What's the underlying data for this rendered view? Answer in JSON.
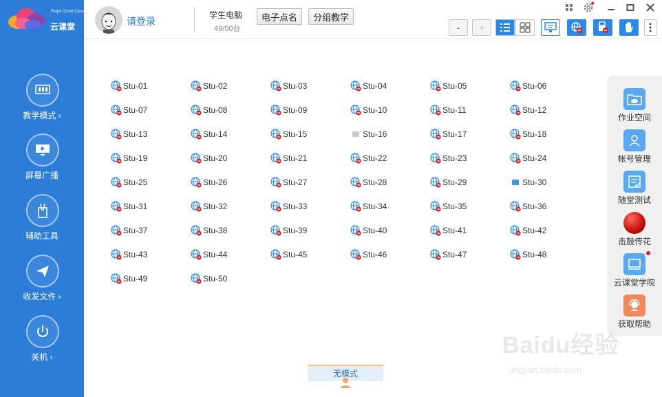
{
  "app": {
    "brand_en": "Ruijie Cloud Class",
    "brand_cn": "云课堂"
  },
  "sidebar": {
    "items": [
      {
        "label": "教学模式 ›",
        "icon": "teaching-mode-icon"
      },
      {
        "label": "屏幕广播",
        "icon": "screen-broadcast-icon"
      },
      {
        "label": "辅助工具",
        "icon": "tools-icon"
      },
      {
        "label": "收发文件 ›",
        "icon": "send-file-icon"
      },
      {
        "label": "关机 ›",
        "icon": "power-icon"
      }
    ]
  },
  "header": {
    "login": "请登录",
    "pc_title": "学生电脑",
    "pc_count": "49/50台",
    "btn_rollcall": "电子点名",
    "btn_group": "分组教学",
    "zoom_minus": "-",
    "zoom_plus": "+"
  },
  "students": [
    "Stu-01",
    "Stu-02",
    "Stu-03",
    "Stu-04",
    "Stu-05",
    "Stu-06",
    "Stu-07",
    "Stu-08",
    "Stu-09",
    "Stu-10",
    "Stu-11",
    "Stu-12",
    "Stu-13",
    "Stu-14",
    "Stu-15",
    "Stu-16",
    "Stu-17",
    "Stu-18",
    "Stu-19",
    "Stu-20",
    "Stu-21",
    "Stu-22",
    "Stu-23",
    "Stu-24",
    "Stu-25",
    "Stu-26",
    "Stu-27",
    "Stu-28",
    "Stu-29",
    "Stu-30",
    "Stu-31",
    "Stu-32",
    "Stu-33",
    "Stu-34",
    "Stu-35",
    "Stu-36",
    "Stu-37",
    "Stu-38",
    "Stu-39",
    "Stu-40",
    "Stu-41",
    "Stu-42",
    "Stu-43",
    "Stu-44",
    "Stu-45",
    "Stu-46",
    "Stu-47",
    "Stu-48",
    "Stu-49",
    "Stu-50"
  ],
  "student_status": {
    "Stu-16": "offline",
    "Stu-30": "online"
  },
  "right_panel": {
    "items": [
      {
        "label": "作业空间",
        "icon": "homework-folder-icon"
      },
      {
        "label": "帐号管理",
        "icon": "account-icon"
      },
      {
        "label": "随堂测试",
        "icon": "quiz-icon"
      },
      {
        "label": "击鼓传花",
        "icon": "drum-ball-icon"
      },
      {
        "label": "云课堂学院",
        "icon": "academy-icon"
      },
      {
        "label": "获取帮助",
        "icon": "help-icon"
      }
    ]
  },
  "mode_bar": {
    "label": "无模式"
  },
  "watermark": {
    "main": "Baidu经验",
    "sub": "jingyan.baidu.com"
  },
  "colors": {
    "sidebar": "#2b7dd8",
    "accent": "#2b88e6",
    "alert": "#e02020"
  }
}
